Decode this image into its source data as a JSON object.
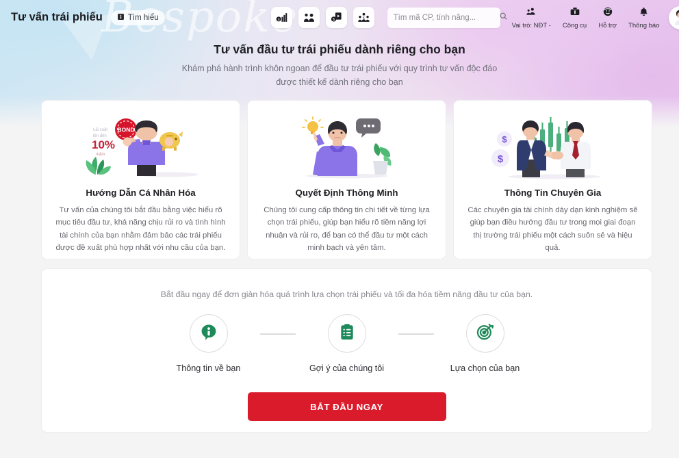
{
  "topbar": {
    "brand": "Tư vấn trái phiếu",
    "learn_more": "Tìm hiểu",
    "learn_icon": "info-square-icon",
    "nav_icons": [
      {
        "name": "bond-chart-icon",
        "title": "Trái phiếu - biểu đồ"
      },
      {
        "name": "people-group-icon",
        "title": "Cộng đồng"
      },
      {
        "name": "video-money-icon",
        "title": "Video"
      },
      {
        "name": "fund-people-icon",
        "title": "Quỹ đầu tư"
      }
    ],
    "search": {
      "placeholder": "Tìm mã CP, tính năng...",
      "value": "",
      "icon": "search-icon"
    },
    "right_items": [
      {
        "label": "Vai trò: NĐT -",
        "icon": "role-user-icon"
      },
      {
        "label": "Công cụ",
        "icon": "toolbox-icon"
      },
      {
        "label": "Hỗ trợ",
        "icon": "support-face-icon"
      },
      {
        "label": "Thông báo",
        "icon": "bell-icon"
      }
    ],
    "avatar": {
      "name": "user-avatar",
      "badge": ""
    }
  },
  "hero": {
    "title": "Tư vấn đầu tư trái phiếu dành riêng cho bạn",
    "subtitle_line1": "Khám phá hành trình khôn ngoan để đầu tư trái phiếu với quy trình tư vấn độc đáo",
    "subtitle_line2": "được thiết kế dành riêng cho bạn",
    "watermark": "Bespoke"
  },
  "cards": [
    {
      "illustration": "man-holding-bond-and-piggybank-illustration",
      "title": "Hướng Dẫn Cá Nhân Hóa",
      "body": "Tư vấn của chúng tôi bắt đầu bằng việc hiểu rõ mục tiêu đầu tư, khả năng chịu rủi ro và tình hình tài chính của bạn nhằm đảm bảo các trái phiếu được đề xuất phù hợp nhất với nhu cầu của bạn.",
      "art_labels": {
        "badge": "BOND",
        "rate": "10%",
        "rate_sub": "năm",
        "caption": "Lãi suất lên đến"
      }
    },
    {
      "illustration": "man-with-idea-lightbulb-illustration",
      "title": "Quyết Định Thông Minh",
      "body": "Chúng tôi cung cấp thông tin chi tiết về từng lựa chọn trái phiếu, giúp bạn hiểu rõ tiềm năng lợi nhuận và rủi ro, để bạn có thể đầu tư một cách minh bạch và yên tâm."
    },
    {
      "illustration": "two-businessmen-handshake-illustration",
      "title": "Thông Tin Chuyên Gia",
      "body": "Các chuyên gia tài chính dày dạn kinh nghiệm sẽ giúp bạn điều hướng đầu tư trong mọi giai đoạn thị trường trái phiếu một cách suôn sẻ và hiệu quả."
    }
  ],
  "panel": {
    "lead": "Bắt đầu ngay để đơn giản hóa quá trình lựa chọn trái phiếu và tối đa hóa tiềm năng đầu tư của bạn.",
    "steps": [
      {
        "label": "Thông tin về bạn",
        "icon": "info-bubble-icon"
      },
      {
        "label": "Gợi ý của chúng tôi",
        "icon": "clipboard-checklist-icon"
      },
      {
        "label": "Lựa chọn của bạn",
        "icon": "target-dart-icon"
      }
    ],
    "cta": "BẮT ĐẦU NGAY"
  },
  "colors": {
    "cta_red": "#da1b2b",
    "step_green": "#1e8a5a",
    "page_bg": "#f4f4f5",
    "title_dark": "#1d1d22",
    "muted": "#70707a"
  }
}
